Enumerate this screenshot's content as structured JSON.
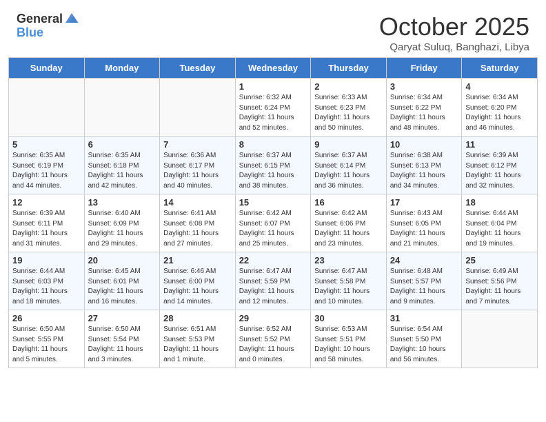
{
  "header": {
    "logo_general": "General",
    "logo_blue": "Blue",
    "month": "October 2025",
    "location": "Qaryat Suluq, Banghazi, Libya"
  },
  "days_of_week": [
    "Sunday",
    "Monday",
    "Tuesday",
    "Wednesday",
    "Thursday",
    "Friday",
    "Saturday"
  ],
  "weeks": [
    {
      "row_class": "row-white",
      "days": [
        {
          "num": "",
          "info": ""
        },
        {
          "num": "",
          "info": ""
        },
        {
          "num": "",
          "info": ""
        },
        {
          "num": "1",
          "info": "Sunrise: 6:32 AM\nSunset: 6:24 PM\nDaylight: 11 hours and 52 minutes."
        },
        {
          "num": "2",
          "info": "Sunrise: 6:33 AM\nSunset: 6:23 PM\nDaylight: 11 hours and 50 minutes."
        },
        {
          "num": "3",
          "info": "Sunrise: 6:34 AM\nSunset: 6:22 PM\nDaylight: 11 hours and 48 minutes."
        },
        {
          "num": "4",
          "info": "Sunrise: 6:34 AM\nSunset: 6:20 PM\nDaylight: 11 hours and 46 minutes."
        }
      ]
    },
    {
      "row_class": "row-gray",
      "days": [
        {
          "num": "5",
          "info": "Sunrise: 6:35 AM\nSunset: 6:19 PM\nDaylight: 11 hours and 44 minutes."
        },
        {
          "num": "6",
          "info": "Sunrise: 6:35 AM\nSunset: 6:18 PM\nDaylight: 11 hours and 42 minutes."
        },
        {
          "num": "7",
          "info": "Sunrise: 6:36 AM\nSunset: 6:17 PM\nDaylight: 11 hours and 40 minutes."
        },
        {
          "num": "8",
          "info": "Sunrise: 6:37 AM\nSunset: 6:15 PM\nDaylight: 11 hours and 38 minutes."
        },
        {
          "num": "9",
          "info": "Sunrise: 6:37 AM\nSunset: 6:14 PM\nDaylight: 11 hours and 36 minutes."
        },
        {
          "num": "10",
          "info": "Sunrise: 6:38 AM\nSunset: 6:13 PM\nDaylight: 11 hours and 34 minutes."
        },
        {
          "num": "11",
          "info": "Sunrise: 6:39 AM\nSunset: 6:12 PM\nDaylight: 11 hours and 32 minutes."
        }
      ]
    },
    {
      "row_class": "row-white",
      "days": [
        {
          "num": "12",
          "info": "Sunrise: 6:39 AM\nSunset: 6:11 PM\nDaylight: 11 hours and 31 minutes."
        },
        {
          "num": "13",
          "info": "Sunrise: 6:40 AM\nSunset: 6:09 PM\nDaylight: 11 hours and 29 minutes."
        },
        {
          "num": "14",
          "info": "Sunrise: 6:41 AM\nSunset: 6:08 PM\nDaylight: 11 hours and 27 minutes."
        },
        {
          "num": "15",
          "info": "Sunrise: 6:42 AM\nSunset: 6:07 PM\nDaylight: 11 hours and 25 minutes."
        },
        {
          "num": "16",
          "info": "Sunrise: 6:42 AM\nSunset: 6:06 PM\nDaylight: 11 hours and 23 minutes."
        },
        {
          "num": "17",
          "info": "Sunrise: 6:43 AM\nSunset: 6:05 PM\nDaylight: 11 hours and 21 minutes."
        },
        {
          "num": "18",
          "info": "Sunrise: 6:44 AM\nSunset: 6:04 PM\nDaylight: 11 hours and 19 minutes."
        }
      ]
    },
    {
      "row_class": "row-gray",
      "days": [
        {
          "num": "19",
          "info": "Sunrise: 6:44 AM\nSunset: 6:03 PM\nDaylight: 11 hours and 18 minutes."
        },
        {
          "num": "20",
          "info": "Sunrise: 6:45 AM\nSunset: 6:01 PM\nDaylight: 11 hours and 16 minutes."
        },
        {
          "num": "21",
          "info": "Sunrise: 6:46 AM\nSunset: 6:00 PM\nDaylight: 11 hours and 14 minutes."
        },
        {
          "num": "22",
          "info": "Sunrise: 6:47 AM\nSunset: 5:59 PM\nDaylight: 11 hours and 12 minutes."
        },
        {
          "num": "23",
          "info": "Sunrise: 6:47 AM\nSunset: 5:58 PM\nDaylight: 11 hours and 10 minutes."
        },
        {
          "num": "24",
          "info": "Sunrise: 6:48 AM\nSunset: 5:57 PM\nDaylight: 11 hours and 9 minutes."
        },
        {
          "num": "25",
          "info": "Sunrise: 6:49 AM\nSunset: 5:56 PM\nDaylight: 11 hours and 7 minutes."
        }
      ]
    },
    {
      "row_class": "row-white",
      "days": [
        {
          "num": "26",
          "info": "Sunrise: 6:50 AM\nSunset: 5:55 PM\nDaylight: 11 hours and 5 minutes."
        },
        {
          "num": "27",
          "info": "Sunrise: 6:50 AM\nSunset: 5:54 PM\nDaylight: 11 hours and 3 minutes."
        },
        {
          "num": "28",
          "info": "Sunrise: 6:51 AM\nSunset: 5:53 PM\nDaylight: 11 hours and 1 minute."
        },
        {
          "num": "29",
          "info": "Sunrise: 6:52 AM\nSunset: 5:52 PM\nDaylight: 11 hours and 0 minutes."
        },
        {
          "num": "30",
          "info": "Sunrise: 6:53 AM\nSunset: 5:51 PM\nDaylight: 10 hours and 58 minutes."
        },
        {
          "num": "31",
          "info": "Sunrise: 6:54 AM\nSunset: 5:50 PM\nDaylight: 10 hours and 56 minutes."
        },
        {
          "num": "",
          "info": ""
        }
      ]
    }
  ]
}
